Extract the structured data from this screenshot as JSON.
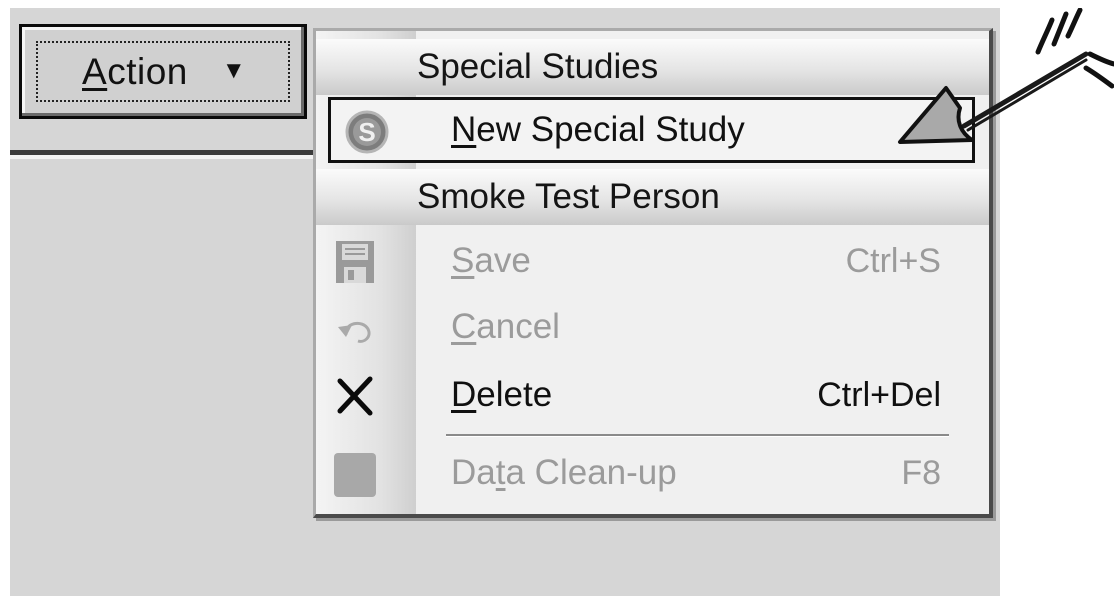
{
  "toolbar": {
    "action_button": {
      "label_underlined": "A",
      "label_rest": "ction",
      "arrow_glyph": "▼"
    }
  },
  "menu": {
    "sections": [
      {
        "header": "Special Studies",
        "items": [
          {
            "label_underlined": "N",
            "label_rest": "ew Special Study",
            "icon": "special-study-s-icon",
            "state": "highlighted"
          }
        ]
      },
      {
        "header": "Smoke Test Person",
        "items": [
          {
            "label_underlined": "S",
            "label_rest": "ave",
            "shortcut": "Ctrl+S",
            "icon": "save-floppy-icon",
            "state": "disabled"
          },
          {
            "label_underlined": "C",
            "label_rest": "ancel",
            "icon": "undo-arrow-icon",
            "state": "disabled"
          },
          {
            "label_underlined": "D",
            "label_rest": "elete",
            "shortcut": "Ctrl+Del",
            "icon": "delete-x-icon",
            "state": "enabled"
          },
          {
            "label_before": "Da",
            "label_underlined": "t",
            "label_after": "a Clean-up",
            "shortcut": "F8",
            "icon": "data-cleanup-icon",
            "state": "disabled"
          }
        ]
      }
    ]
  },
  "annotation": {
    "icon": "hand-drawn-arrow-icon",
    "points_to": "New Special Study"
  },
  "colors": {
    "workspace": "#d6d6d6",
    "menu_bg": "#f0f0f0",
    "disabled_text": "#9b9b9b",
    "highlight_border": "#111111"
  }
}
